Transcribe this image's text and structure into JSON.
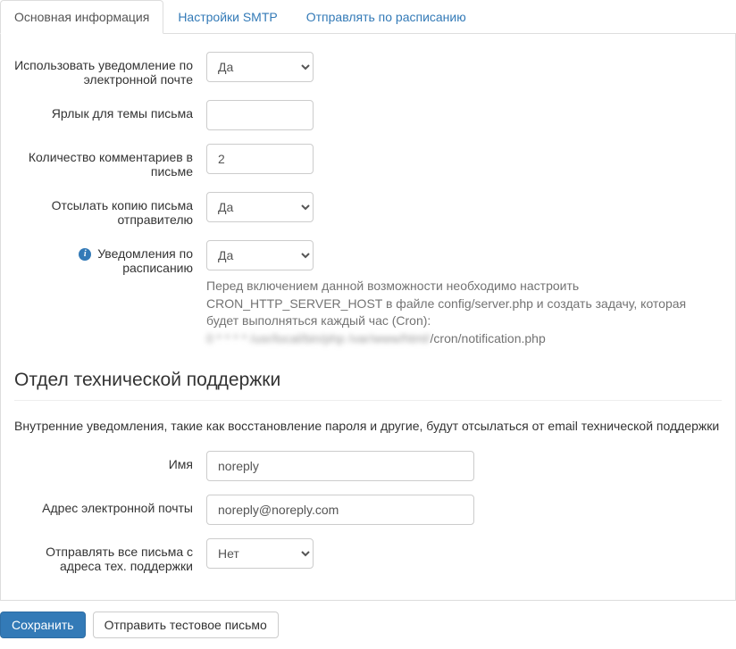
{
  "tabs": {
    "main": "Основная информация",
    "smtp": "Настройки SMTP",
    "schedule": "Отправлять по расписанию"
  },
  "form": {
    "use_email_notification": {
      "label": "Использовать уведомление по электронной почте",
      "value": "Да"
    },
    "subject_label": {
      "label": "Ярлык для темы письма",
      "value": ""
    },
    "comments_count": {
      "label": "Количество комментариев в письме",
      "value": "2"
    },
    "send_copy": {
      "label": "Отсылать копию письма отправителю",
      "value": "Да"
    },
    "scheduled_notifications": {
      "label": "Уведомления по расписанию",
      "value": "Да",
      "help_line1": "Перед включением данной возможности необходимо настроить CRON_HTTP_SERVER_HOST в файле config/server.php и создать задачу, которая будет выполняться каждый час (Cron):",
      "help_blurred": "0 * * * * /usr/local/bin/php /var/www/html/",
      "help_suffix": "/cron/notification.php"
    }
  },
  "support": {
    "heading": "Отдел технической поддержки",
    "intro": "Внутренние уведомления, такие как восстановление пароля и другие, будут отсылаться от email технической поддержки",
    "name": {
      "label": "Имя",
      "value": "noreply"
    },
    "email": {
      "label": "Адрес электронной почты",
      "value": "noreply@noreply.com"
    },
    "send_all_from_support": {
      "label": "Отправлять все письма с адреса тех. поддержки",
      "value": "Нет"
    }
  },
  "actions": {
    "save": "Сохранить",
    "send_test": "Отправить тестовое письмо"
  },
  "options": {
    "yes": "Да",
    "no": "Нет"
  }
}
